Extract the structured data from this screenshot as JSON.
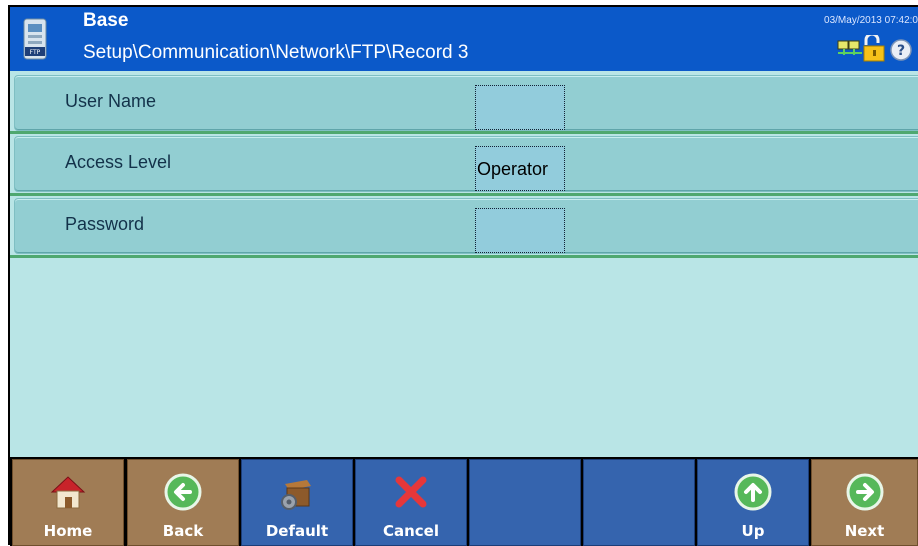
{
  "header": {
    "title": "Base",
    "path": "Setup\\Communication\\Network\\FTP\\Record 3",
    "datetime": "03/May/2013 07:42:0"
  },
  "fields": [
    {
      "label": "User Name",
      "value": ""
    },
    {
      "label": "Access Level",
      "value": "Operator"
    },
    {
      "label": "Password",
      "value": ""
    }
  ],
  "softkeys": [
    {
      "label": "Home",
      "icon": "home-icon"
    },
    {
      "label": "Back",
      "icon": "back-arrow-icon"
    },
    {
      "label": "Default",
      "icon": "default-box-icon"
    },
    {
      "label": "Cancel",
      "icon": "cancel-x-icon"
    },
    {
      "label": "",
      "icon": ""
    },
    {
      "label": "",
      "icon": ""
    },
    {
      "label": "Up",
      "icon": "up-arrow-icon"
    },
    {
      "label": "Next",
      "icon": "next-arrow-icon"
    }
  ],
  "colors": {
    "header_bg": "#0b59c9",
    "content_bg": "#b9e5e6",
    "row_bg": "#92ced2",
    "softkey_brown": "#a07c55",
    "softkey_blue": "#3564ae"
  }
}
